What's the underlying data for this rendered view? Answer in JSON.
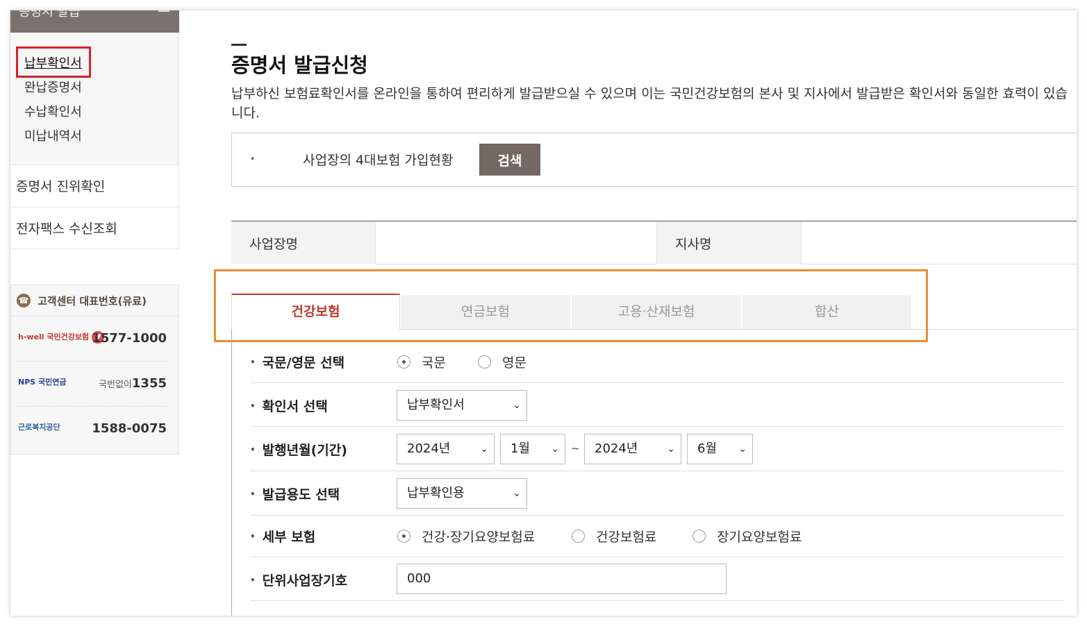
{
  "sidebar": {
    "header": "증명서 발급",
    "sub_items": [
      "납부확인서",
      "완납증명서",
      "수납확인서",
      "미납내역서"
    ],
    "links": [
      "증명서 진위확인",
      "전자팩스 수신조회"
    ],
    "customer_center": {
      "title": "고객센터 대표번호(유료)",
      "rows": [
        {
          "org": "h-well 국민건강보험",
          "number": "1577-1000",
          "prefix": ""
        },
        {
          "org": "NPS 국민연금",
          "number": "1355",
          "prefix": "국번없이"
        },
        {
          "org": "근로복지공단",
          "number": "1588-0075",
          "prefix": ""
        }
      ]
    }
  },
  "main": {
    "title": "증명서 발급신청",
    "description": "납부하신 보험료확인서를 온라인을 통하여 편리하게 발급받으실 수 있으며 이는 국민건강보험의 본사 및 지사에서 발급받은 확인서와 동일한 효력이 있습니다.",
    "search": {
      "label": "사업장의 4대보험 가입현황",
      "button": "검색"
    },
    "info": {
      "business_name_label": "사업장명",
      "branch_label": "지사명"
    },
    "tabs": [
      {
        "label": "건강보험",
        "active": true
      },
      {
        "label": "연금보험",
        "active": false
      },
      {
        "label": "고용·산재보험",
        "active": false
      },
      {
        "label": "합산",
        "active": false
      }
    ],
    "form": {
      "language": {
        "label": "국문/영문 선택",
        "options": [
          "국문",
          "영문"
        ],
        "selected": "국문"
      },
      "certificate": {
        "label": "확인서 선택",
        "value": "납부확인서"
      },
      "period": {
        "label": "발행년월(기간)",
        "from_year": "2024년",
        "from_month": "1월",
        "separator": "~",
        "to_year": "2024년",
        "to_month": "6월"
      },
      "purpose": {
        "label": "발급용도 선택",
        "value": "납부확인용"
      },
      "detail": {
        "label": "세부 보험",
        "options": [
          "건강·장기요양보험료",
          "건강보험료",
          "장기요양보험료"
        ],
        "selected": "건강·장기요양보험료"
      },
      "unit_code": {
        "label": "단위사업장기호",
        "value": "000"
      }
    }
  },
  "colors": {
    "accent_red": "#c0392b",
    "highlight_orange": "#f08a33",
    "highlight_red": "#d7202a",
    "button_brown": "#736862"
  }
}
